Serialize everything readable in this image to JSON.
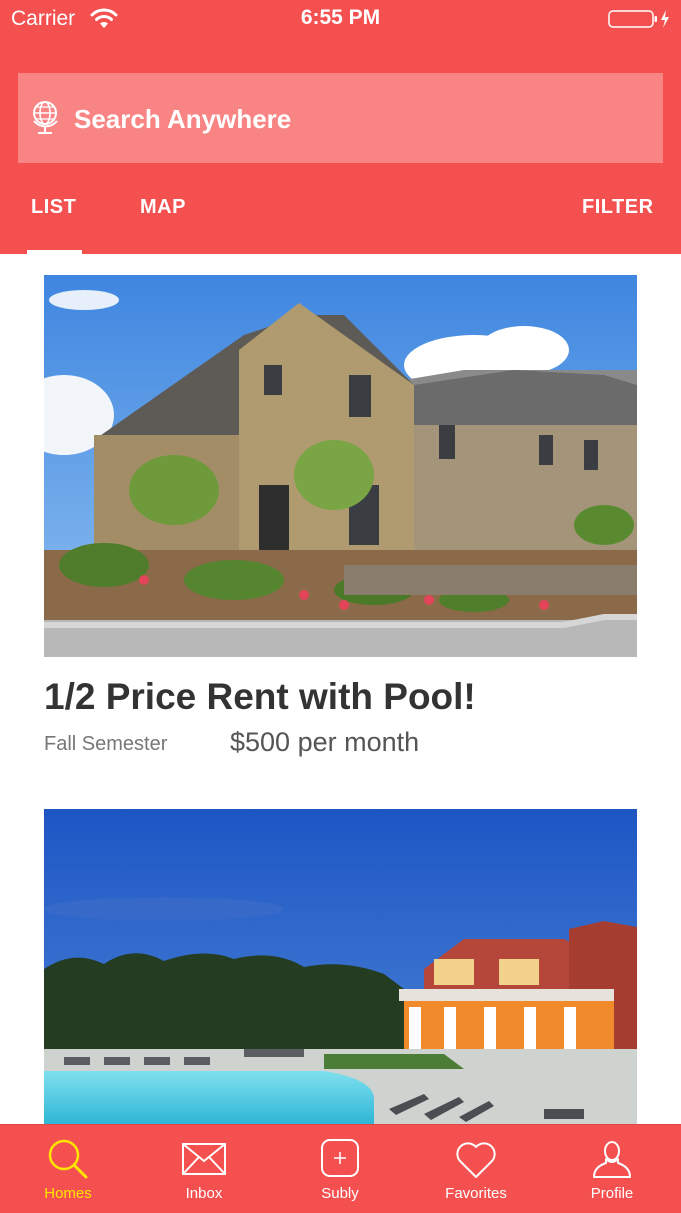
{
  "status_bar": {
    "carrier": "Carrier",
    "time": "6:55 PM",
    "icons": [
      "wifi-icon",
      "battery-icon",
      "charging-bolt-icon"
    ]
  },
  "search": {
    "placeholder": "Search Anywhere",
    "icon": "globe-icon"
  },
  "tabs": [
    {
      "label": "LIST",
      "selected": true
    },
    {
      "label": "MAP",
      "selected": false
    }
  ],
  "filter_label": "FILTER",
  "listings": [
    {
      "title": "1/2 Price Rent with Pool!",
      "term": "Fall Semester",
      "price": "$500 per month",
      "image": "brick townhouse exterior"
    },
    {
      "image": "apartment pool at dusk"
    }
  ],
  "tab_bar": [
    {
      "label": "Homes",
      "icon": "search-icon",
      "active": true
    },
    {
      "label": "Inbox",
      "icon": "mail-icon",
      "active": false
    },
    {
      "label": "Subly",
      "icon": "plus-square-icon",
      "active": false
    },
    {
      "label": "Favorites",
      "icon": "heart-icon",
      "active": false
    },
    {
      "label": "Profile",
      "icon": "person-icon",
      "active": false
    }
  ],
  "colors": {
    "brand": "#f55050",
    "active_tab": "#ffe600",
    "text_dark": "#333333"
  }
}
